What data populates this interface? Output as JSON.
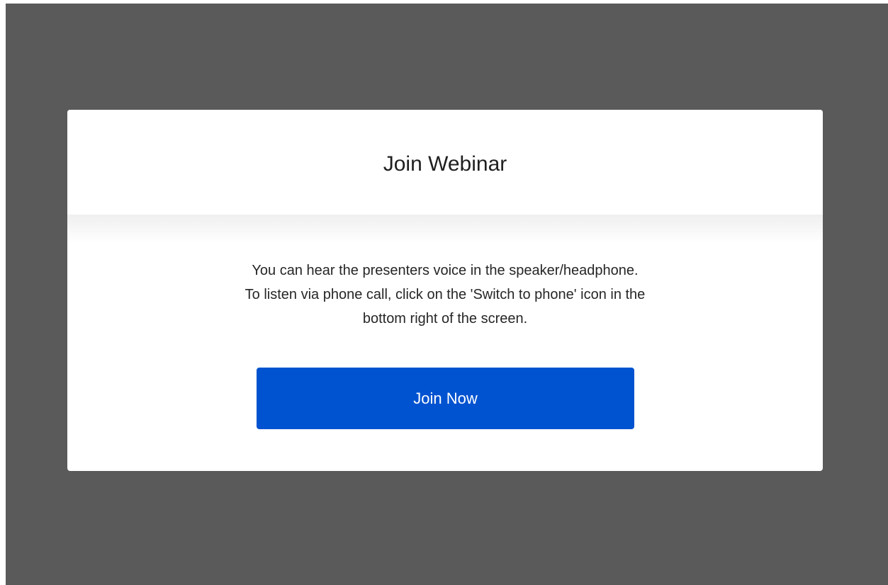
{
  "dialog": {
    "title": "Join Webinar",
    "message_lines": [
      "You can hear the presenters voice in the speaker/headphone.",
      "To listen via phone call, click on the 'Switch to phone' icon in the",
      "bottom right of the screen."
    ],
    "join_button_label": "Join Now"
  },
  "colors": {
    "backdrop": "#5a5a5a",
    "dialog_background": "#ffffff",
    "button_background": "#0053d0",
    "button_text": "#ffffff"
  }
}
